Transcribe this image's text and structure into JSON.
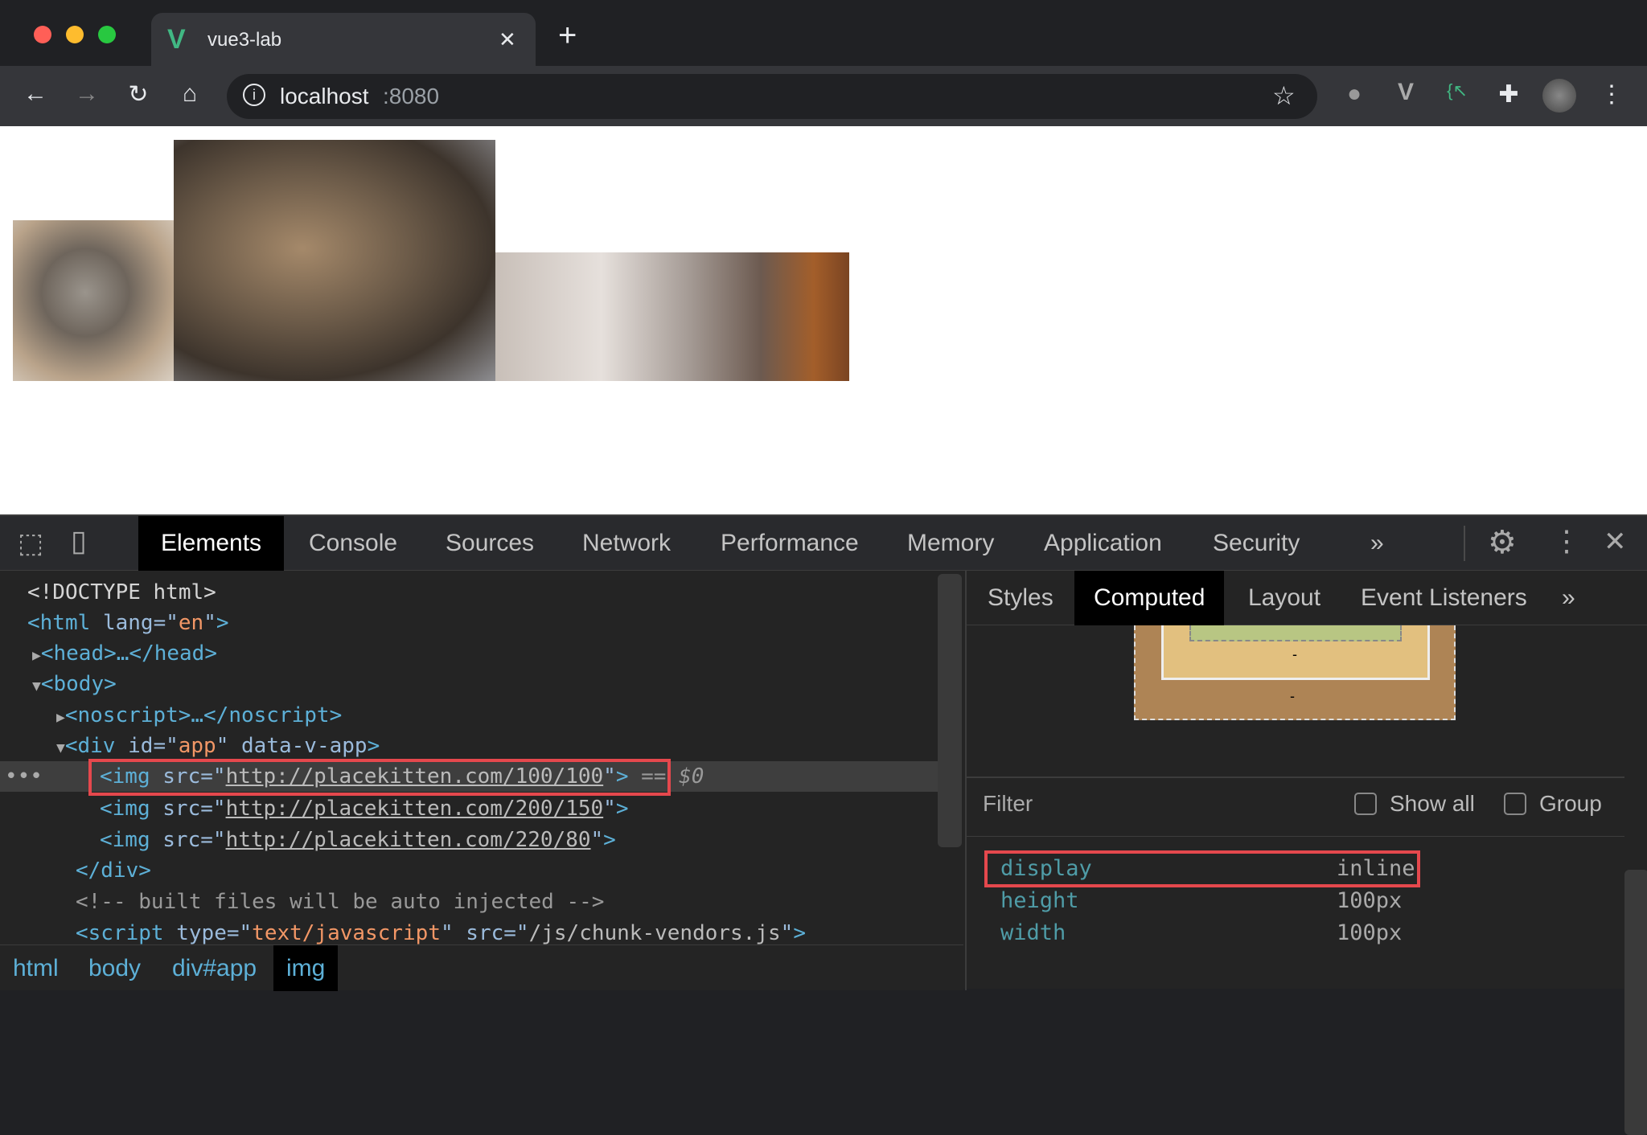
{
  "browser": {
    "tab_title": "vue3-lab",
    "new_tab": "+",
    "close_tab": "✕",
    "url_host": "localhost",
    "url_port": ":8080"
  },
  "page": {
    "images": [
      {
        "alt": "kitten 100x100"
      },
      {
        "alt": "kitten 200x150"
      },
      {
        "alt": "kitten 220x80"
      }
    ]
  },
  "devtools": {
    "tabs": [
      "Elements",
      "Console",
      "Sources",
      "Network",
      "Performance",
      "Memory",
      "Application",
      "Security"
    ],
    "active_tab": "Elements",
    "more": "»",
    "dom": {
      "doctype": "<!DOCTYPE html>",
      "html_open": "<html",
      "lang_attr": "lang",
      "lang_val": "en",
      "head": "<head>…</head>",
      "body": "<body>",
      "noscript": "<noscript>…</noscript>",
      "div_open": "<div",
      "id_attr": "id",
      "id_val": "app",
      "data_attr": "data-v-app",
      "img_tag": "<img",
      "src_attr": "src",
      "imgs": [
        "http://placekitten.com/100/100",
        "http://placekitten.com/200/150",
        "http://placekitten.com/220/80"
      ],
      "selected_marker": "== $0",
      "div_close": "</div>",
      "comment": "<!-- built files will be auto injected -->",
      "script_open": "<script",
      "type_attr": "type",
      "type_val": "text/javascript",
      "script_src": "/js/chunk-vendors.js"
    },
    "breadcrumb": [
      "html",
      "body",
      "div#app",
      "img"
    ],
    "side_tabs": [
      "Styles",
      "Computed",
      "Layout",
      "Event Listeners"
    ],
    "active_side_tab": "Computed",
    "box_model": {
      "padding": "-",
      "margin": "-"
    },
    "filter_label": "Filter",
    "show_all": {
      "label": "Show all",
      "checked": false
    },
    "group": {
      "label": "Group",
      "checked": false
    },
    "properties": [
      {
        "name": "display",
        "value": "inline"
      },
      {
        "name": "height",
        "value": "100px"
      },
      {
        "name": "width",
        "value": "100px"
      }
    ]
  },
  "colors": {
    "highlight": "#e5484d",
    "vue_green": "#41b883"
  }
}
